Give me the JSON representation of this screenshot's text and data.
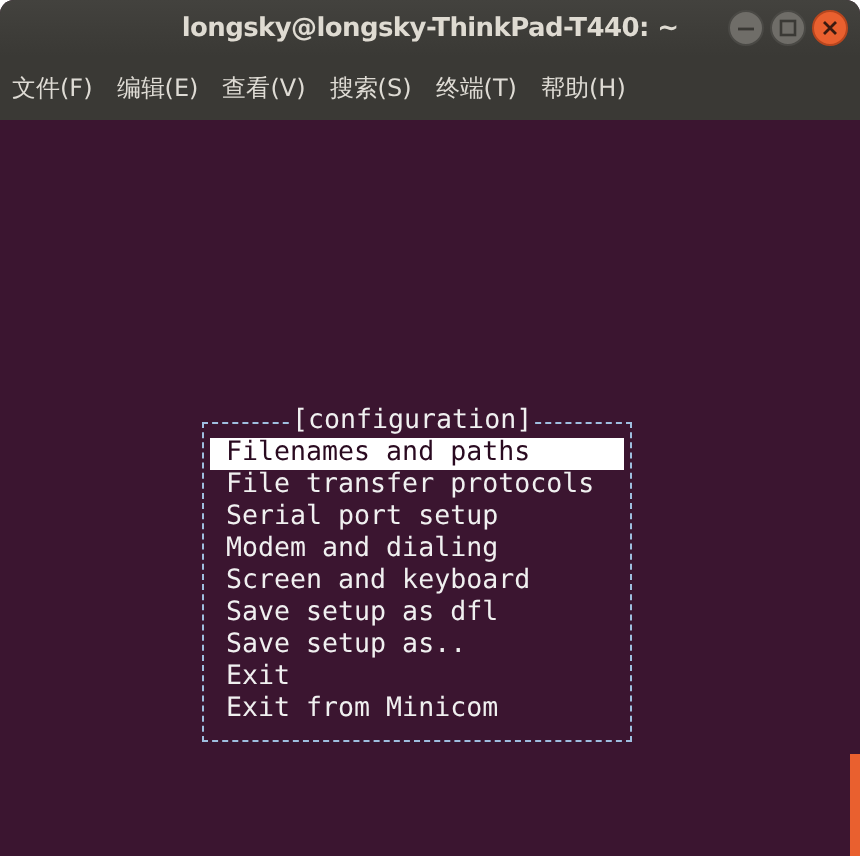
{
  "window": {
    "title": "longsky@longsky-ThinkPad-T440: ~"
  },
  "menu": [
    "文件(F)",
    "编辑(E)",
    "查看(V)",
    "搜索(S)",
    "终端(T)",
    "帮助(H)"
  ],
  "dialog": {
    "title": "[configuration]",
    "items": [
      {
        "label": "Filenames and paths",
        "selected": true
      },
      {
        "label": "File transfer protocols",
        "selected": false
      },
      {
        "label": "Serial port setup",
        "selected": false
      },
      {
        "label": "Modem and dialing",
        "selected": false
      },
      {
        "label": "Screen and keyboard",
        "selected": false
      },
      {
        "label": "Save setup as dfl",
        "selected": false
      },
      {
        "label": "Save setup as..",
        "selected": false
      },
      {
        "label": "Exit",
        "selected": false
      },
      {
        "label": "Exit from Minicom",
        "selected": false
      }
    ]
  }
}
